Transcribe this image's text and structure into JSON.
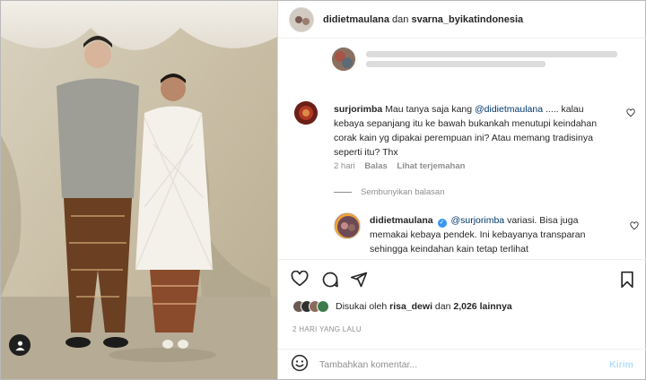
{
  "post": {
    "author": "didietmaulana",
    "connector": "dan",
    "coauthor": "svarna_byikatindonesia"
  },
  "icons": {
    "tag": "user-tag-icon",
    "heart": "heart-icon",
    "comment": "comment-icon",
    "share": "send-icon",
    "save": "bookmark-icon",
    "emoji": "smiley-icon"
  },
  "comment": {
    "user": "surjorimba",
    "text_before": "Mau tanya saja kang",
    "mention": "@didietmaulana",
    "text_after": "..... kalau kebaya sepanjang itu ke bawah bukankah menutupi keindahan corak kain yg dipakai perempuan ini? Atau memang tradisinya seperti itu? Thx",
    "time": "2 hari",
    "reply_label": "Balas",
    "translate_label": "Lihat terjemahan"
  },
  "hide_replies": "Sembunyikan balasan",
  "reply": {
    "user": "didietmaulana",
    "mention": "@surjorimba",
    "text": "variasi. Bisa juga memakai kebaya pendek. Ini kebayanya transparan sehingga keindahan kain tetap terlihat"
  },
  "likes": {
    "prefix": "Disukai oleh",
    "user": "risa_dewi",
    "connector": "dan",
    "count": "2,026 lainnya"
  },
  "date": "2 HARI YANG LALU",
  "add_comment": {
    "placeholder": "Tambahkan komentar...",
    "send_label": "Kirim"
  },
  "colors": {
    "link": "#00376b",
    "muted": "#8e8e8e",
    "verified": "#3897f0",
    "send_disabled": "#b2dffc"
  }
}
